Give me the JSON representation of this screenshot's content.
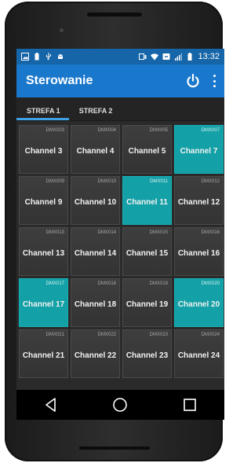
{
  "status_bar": {
    "time": "13:32"
  },
  "app_bar": {
    "title": "Sterowanie"
  },
  "tabs": [
    {
      "label": "STREFA 1",
      "active": true
    },
    {
      "label": "STREFA 2",
      "active": false
    }
  ],
  "channels": [
    {
      "dmx": "DMX003",
      "label": "Channel 3",
      "on": false
    },
    {
      "dmx": "DMX004",
      "label": "Channel 4",
      "on": false
    },
    {
      "dmx": "DMX005",
      "label": "Channel 5",
      "on": false
    },
    {
      "dmx": "DMX007",
      "label": "Channel 7",
      "on": true
    },
    {
      "dmx": "DMX009",
      "label": "Channel 9",
      "on": false
    },
    {
      "dmx": "DMX010",
      "label": "Channel 10",
      "on": false
    },
    {
      "dmx": "DMX011",
      "label": "Channel 11",
      "on": true
    },
    {
      "dmx": "DMX012",
      "label": "Channel 12",
      "on": false
    },
    {
      "dmx": "DMX013",
      "label": "Channel 13",
      "on": false
    },
    {
      "dmx": "DMX014",
      "label": "Channel 14",
      "on": false
    },
    {
      "dmx": "DMX015",
      "label": "Channel 15",
      "on": false
    },
    {
      "dmx": "DMX016",
      "label": "Channel 16",
      "on": false
    },
    {
      "dmx": "DMX017",
      "label": "Channel 17",
      "on": true
    },
    {
      "dmx": "DMX018",
      "label": "Channel 18",
      "on": false
    },
    {
      "dmx": "DMX019",
      "label": "Channel 19",
      "on": false
    },
    {
      "dmx": "DMX020",
      "label": "Channel 20",
      "on": true
    },
    {
      "dmx": "DMX021",
      "label": "Channel 21",
      "on": false
    },
    {
      "dmx": "DMX022",
      "label": "Channel 22",
      "on": false
    },
    {
      "dmx": "DMX023",
      "label": "Channel 23",
      "on": false
    },
    {
      "dmx": "DMX024",
      "label": "Channel 24",
      "on": false
    }
  ],
  "nav_bar": {
    "buttons": [
      "back-icon",
      "home-icon",
      "recents-icon"
    ]
  },
  "colors": {
    "appbar": "#1977cc",
    "statusbar": "#1565a8",
    "channel_on": "#13a0a6",
    "tab_indicator": "#3ea2e6"
  }
}
